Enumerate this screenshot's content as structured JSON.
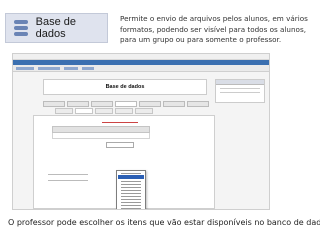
{
  "badge": {
    "title": "Base de dados",
    "icon": "database-icon"
  },
  "description": "Permite o envio de arquivos pelos alunos, em vários formatos, podendo ser visível para todos os alunos, para um grupo ou para somente o professor.",
  "screenshot": {
    "page_heading": "Base de dados"
  },
  "caption": "O professor pode escolher os itens que vão estar disponíveis no banco de dados."
}
